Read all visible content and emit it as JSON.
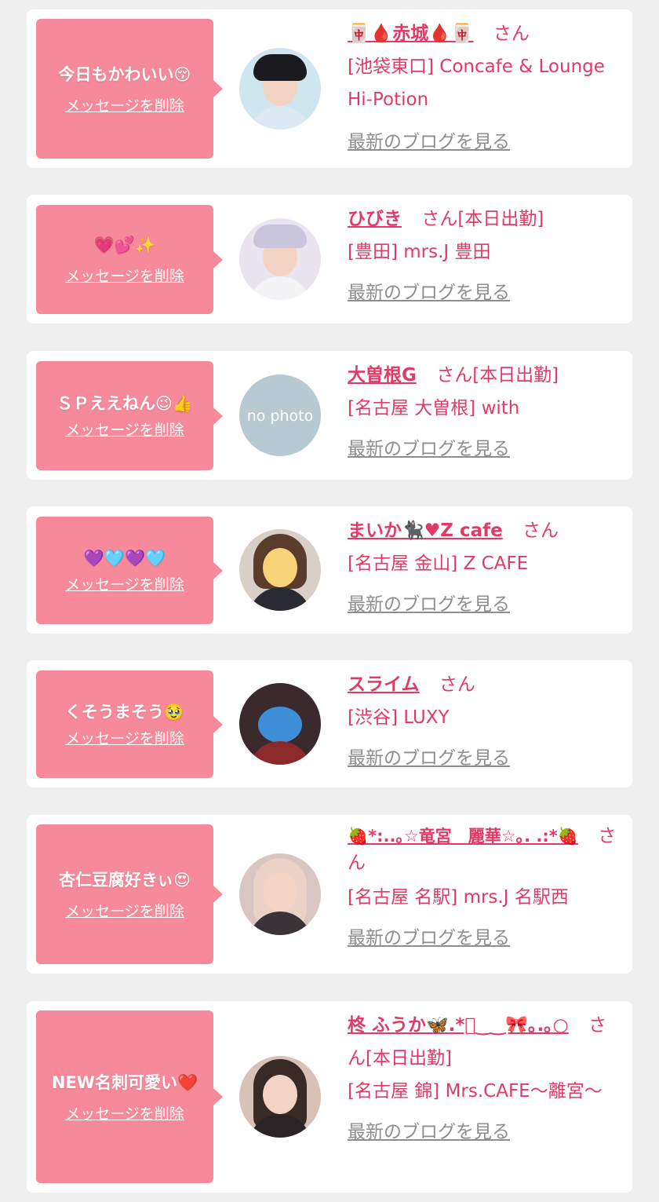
{
  "delete_label": "メッセージを削除",
  "san_label": "さん",
  "blog_label": "最新のブログを見る",
  "cards": [
    {
      "message": "今日もかわいい😚",
      "name": "🀄🩸赤城🩸🀄",
      "suffix": "",
      "shop": "[池袋東口] Concafe & Lounge Hi-Potion",
      "avatar": "photo-short-black-hair"
    },
    {
      "message": "💗💕✨",
      "name": "ひびき",
      "suffix": "[本日出勤]",
      "shop": "[豊田] mrs.J 豊田",
      "avatar": "photo-silver-hair-hat"
    },
    {
      "message": "ＳＰええねん😉👍",
      "name": "大曽根G",
      "suffix": "[本日出勤]",
      "shop": "[名古屋 大曽根] with",
      "avatar": "no-photo"
    },
    {
      "message": "💜🩵💜🩵",
      "name": "まいか🐈‍⬛♥Z cafe",
      "suffix": "",
      "shop": "[名古屋 金山] Z CAFE",
      "avatar": "photo-brown-hair-emoji-face"
    },
    {
      "message": "くそうまそう🥹",
      "name": "スライム",
      "suffix": "",
      "shop": "[渋谷] LUXY",
      "avatar": "photo-slime-mask"
    },
    {
      "message": "杏仁豆腐好きぃ😍",
      "name": "🍓*:..｡☆竜宮　麗華☆｡. .:*🍓",
      "suffix": "",
      "shop": "[名古屋 名駅] mrs.J 名駅西",
      "avatar": "photo-blonde-peace-sign"
    },
    {
      "message": "NEW名刺可愛い❤️",
      "name": "柊 ふうか🦋.*ﾟ‿‿🎀｡.｡○",
      "suffix": "[本日出勤]",
      "shop": "[名古屋 錦] Mrs.CAFE〜離宮〜",
      "avatar": "photo-long-dark-hair"
    }
  ]
}
